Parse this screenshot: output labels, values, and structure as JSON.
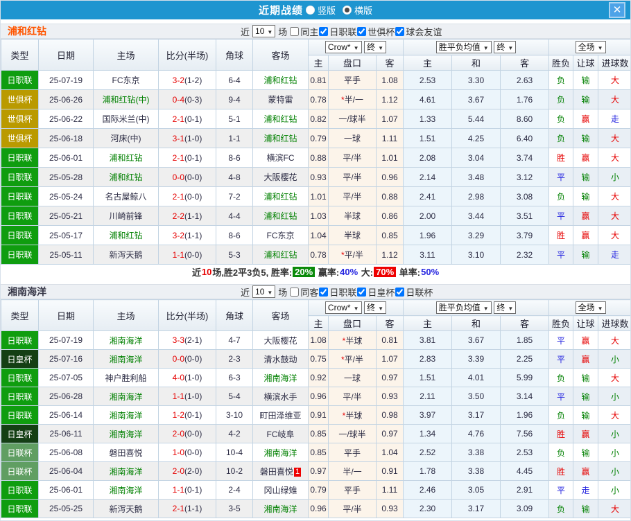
{
  "titlebar": {
    "title": "近期战绩",
    "radio_options": [
      {
        "label": "竖版",
        "selected": false
      },
      {
        "label": "横版",
        "selected": true
      }
    ],
    "close_label": "✕"
  },
  "columns": {
    "type": "类型",
    "date": "日期",
    "home": "主场",
    "score": "比分(半场)",
    "corners": "角球",
    "away": "客场",
    "odds_group": {
      "dropdown1": "Crow*",
      "dropdown2": "终",
      "sub": [
        "主",
        "盘口",
        "客"
      ]
    },
    "mean_group": {
      "dropdown1": "胜平负均值",
      "dropdown2": "终",
      "sub": [
        "主",
        "和",
        "客"
      ]
    },
    "result_group": {
      "dropdown": "全场",
      "sub": [
        "胜负",
        "让球",
        "进球数"
      ]
    }
  },
  "colors": {
    "red": "#e60000",
    "green": "#008000",
    "blue": "#2424e0",
    "dark": "#2c2c44"
  },
  "comp_colors": {
    "日职联": "#0f9d0f",
    "世俱杯": "#ba9a00",
    "日皇杯": "#143f14",
    "日联杯": "#609e62"
  },
  "sections": [
    {
      "team": "浦和红钻",
      "team_color": "#ff5500",
      "filters": {
        "near_label": "近",
        "count": "10",
        "games_label": "场",
        "checkboxes": [
          {
            "label": "同主",
            "checked": false
          },
          {
            "label": "日职联",
            "checked": true
          },
          {
            "label": "世俱杯",
            "checked": true
          },
          {
            "label": "球会友谊",
            "checked": true
          }
        ]
      },
      "rows": [
        {
          "comp": "日职联",
          "date": "25-07-19",
          "home": "FC东京",
          "home_self": false,
          "score": "3-2",
          "half": "(1-2)",
          "corners": "6-4",
          "away": "浦和红钻",
          "away_self": true,
          "o1": "0.81",
          "hstar": false,
          "hcap": "平手",
          "o2": "1.08",
          "m1": "2.53",
          "m2": "3.30",
          "m3": "2.63",
          "res": "负",
          "res_c": "g",
          "let": "输",
          "let_c": "g",
          "goal": "大",
          "goal_c": "r"
        },
        {
          "comp": "世俱杯",
          "date": "25-06-26",
          "home": "浦和红钻(中)",
          "home_self": true,
          "score": "0-4",
          "half": "(0-3)",
          "corners": "9-4",
          "away": "蒙特雷",
          "away_self": false,
          "o1": "0.78",
          "hstar": true,
          "hcap": "半/一",
          "o2": "1.12",
          "m1": "4.61",
          "m2": "3.67",
          "m3": "1.76",
          "res": "负",
          "res_c": "g",
          "let": "输",
          "let_c": "g",
          "goal": "大",
          "goal_c": "r"
        },
        {
          "comp": "世俱杯",
          "date": "25-06-22",
          "home": "国际米兰(中)",
          "home_self": false,
          "score": "2-1",
          "half": "(0-1)",
          "corners": "5-1",
          "away": "浦和红钻",
          "away_self": true,
          "o1": "0.82",
          "hstar": false,
          "hcap": "一/球半",
          "o2": "1.07",
          "m1": "1.33",
          "m2": "5.44",
          "m3": "8.60",
          "res": "负",
          "res_c": "g",
          "let": "赢",
          "let_c": "r",
          "goal": "走",
          "goal_c": "b"
        },
        {
          "comp": "世俱杯",
          "date": "25-06-18",
          "home": "河床(中)",
          "home_self": false,
          "score": "3-1",
          "half": "(1-0)",
          "corners": "1-1",
          "away": "浦和红钻",
          "away_self": true,
          "o1": "0.79",
          "hstar": false,
          "hcap": "一球",
          "o2": "1.11",
          "m1": "1.51",
          "m2": "4.25",
          "m3": "6.40",
          "res": "负",
          "res_c": "g",
          "let": "输",
          "let_c": "g",
          "goal": "大",
          "goal_c": "r"
        },
        {
          "comp": "日职联",
          "date": "25-06-01",
          "home": "浦和红钻",
          "home_self": true,
          "score": "2-1",
          "half": "(0-1)",
          "corners": "8-6",
          "away": "横滨FC",
          "away_self": false,
          "o1": "0.88",
          "hstar": false,
          "hcap": "平/半",
          "o2": "1.01",
          "m1": "2.08",
          "m2": "3.04",
          "m3": "3.74",
          "res": "胜",
          "res_c": "r",
          "let": "赢",
          "let_c": "r",
          "goal": "大",
          "goal_c": "r"
        },
        {
          "comp": "日职联",
          "date": "25-05-28",
          "home": "浦和红钻",
          "home_self": true,
          "score": "0-0",
          "half": "(0-0)",
          "corners": "4-8",
          "away": "大阪樱花",
          "away_self": false,
          "o1": "0.93",
          "hstar": false,
          "hcap": "平/半",
          "o2": "0.96",
          "m1": "2.14",
          "m2": "3.48",
          "m3": "3.12",
          "res": "平",
          "res_c": "b",
          "let": "输",
          "let_c": "g",
          "goal": "小",
          "goal_c": "g"
        },
        {
          "comp": "日职联",
          "date": "25-05-24",
          "home": "名古屋鲸八",
          "home_self": false,
          "score": "2-1",
          "half": "(0-0)",
          "corners": "7-2",
          "away": "浦和红钻",
          "away_self": true,
          "o1": "1.01",
          "hstar": false,
          "hcap": "平/半",
          "o2": "0.88",
          "m1": "2.41",
          "m2": "2.98",
          "m3": "3.08",
          "res": "负",
          "res_c": "g",
          "let": "输",
          "let_c": "g",
          "goal": "大",
          "goal_c": "r"
        },
        {
          "comp": "日职联",
          "date": "25-05-21",
          "home": "川崎前锋",
          "home_self": false,
          "score": "2-2",
          "half": "(1-1)",
          "corners": "4-4",
          "away": "浦和红钻",
          "away_self": true,
          "o1": "1.03",
          "hstar": false,
          "hcap": "半球",
          "o2": "0.86",
          "m1": "2.00",
          "m2": "3.44",
          "m3": "3.51",
          "res": "平",
          "res_c": "b",
          "let": "赢",
          "let_c": "r",
          "goal": "大",
          "goal_c": "r"
        },
        {
          "comp": "日职联",
          "date": "25-05-17",
          "home": "浦和红钻",
          "home_self": true,
          "score": "3-2",
          "half": "(1-1)",
          "corners": "8-6",
          "away": "FC东京",
          "away_self": false,
          "o1": "1.04",
          "hstar": false,
          "hcap": "半球",
          "o2": "0.85",
          "m1": "1.96",
          "m2": "3.29",
          "m3": "3.79",
          "res": "胜",
          "res_c": "r",
          "let": "赢",
          "let_c": "r",
          "goal": "大",
          "goal_c": "r"
        },
        {
          "comp": "日职联",
          "date": "25-05-11",
          "home": "新泻天鹅",
          "home_self": false,
          "score": "1-1",
          "half": "(0-0)",
          "corners": "5-3",
          "away": "浦和红钻",
          "away_self": true,
          "o1": "0.78",
          "hstar": true,
          "hcap": "平/半",
          "o2": "1.12",
          "m1": "3.11",
          "m2": "3.10",
          "m3": "2.32",
          "res": "平",
          "res_c": "b",
          "let": "输",
          "let_c": "g",
          "goal": "走",
          "goal_c": "b"
        }
      ],
      "summary": [
        {
          "t": "近",
          "c": "#333333"
        },
        {
          "t": "10",
          "c": "#e60000"
        },
        {
          "t": "场,胜2平3负5, 胜率:",
          "c": "#333333"
        },
        {
          "t": "20%",
          "c": "#ffffff",
          "bg": "#0a8a0a"
        },
        {
          "t": " 赢率:",
          "c": "#333333"
        },
        {
          "t": "40%",
          "c": "#2424e0"
        },
        {
          "t": " 大:",
          "c": "#333333"
        },
        {
          "t": "70%",
          "c": "#ffffff",
          "bg": "#ee0000"
        },
        {
          "t": " 单率:",
          "c": "#333333"
        },
        {
          "t": "50%",
          "c": "#2424e0"
        }
      ]
    },
    {
      "team": "湘南海洋",
      "team_color": "#333344",
      "filters": {
        "near_label": "近",
        "count": "10",
        "games_label": "场",
        "checkboxes": [
          {
            "label": "同客",
            "checked": false
          },
          {
            "label": "日职联",
            "checked": true
          },
          {
            "label": "日皇杯",
            "checked": true
          },
          {
            "label": "日联杯",
            "checked": true
          }
        ]
      },
      "rows": [
        {
          "comp": "日职联",
          "date": "25-07-19",
          "home": "湘南海洋",
          "home_self": true,
          "score": "3-3",
          "half": "(2-1)",
          "corners": "4-7",
          "away": "大阪樱花",
          "away_self": false,
          "o1": "1.08",
          "hstar": true,
          "hcap": "半球",
          "o2": "0.81",
          "m1": "3.81",
          "m2": "3.67",
          "m3": "1.85",
          "res": "平",
          "res_c": "b",
          "let": "赢",
          "let_c": "r",
          "goal": "大",
          "goal_c": "r"
        },
        {
          "comp": "日皇杯",
          "date": "25-07-16",
          "home": "湘南海洋",
          "home_self": true,
          "score": "0-0",
          "half": "(0-0)",
          "corners": "2-3",
          "away": "清水鼓动",
          "away_self": false,
          "o1": "0.75",
          "hstar": true,
          "hcap": "平/半",
          "o2": "1.07",
          "m1": "2.83",
          "m2": "3.39",
          "m3": "2.25",
          "res": "平",
          "res_c": "b",
          "let": "赢",
          "let_c": "r",
          "goal": "小",
          "goal_c": "g"
        },
        {
          "comp": "日职联",
          "date": "25-07-05",
          "home": "神户胜利船",
          "home_self": false,
          "score": "4-0",
          "half": "(1-0)",
          "corners": "6-3",
          "away": "湘南海洋",
          "away_self": true,
          "o1": "0.92",
          "hstar": false,
          "hcap": "一球",
          "o2": "0.97",
          "m1": "1.51",
          "m2": "4.01",
          "m3": "5.99",
          "res": "负",
          "res_c": "g",
          "let": "输",
          "let_c": "g",
          "goal": "大",
          "goal_c": "r"
        },
        {
          "comp": "日职联",
          "date": "25-06-28",
          "home": "湘南海洋",
          "home_self": true,
          "score": "1-1",
          "half": "(1-0)",
          "corners": "5-4",
          "away": "横滨水手",
          "away_self": false,
          "o1": "0.96",
          "hstar": false,
          "hcap": "平/半",
          "o2": "0.93",
          "m1": "2.11",
          "m2": "3.50",
          "m3": "3.14",
          "res": "平",
          "res_c": "b",
          "let": "输",
          "let_c": "g",
          "goal": "小",
          "goal_c": "g"
        },
        {
          "comp": "日职联",
          "date": "25-06-14",
          "home": "湘南海洋",
          "home_self": true,
          "score": "1-2",
          "half": "(0-1)",
          "corners": "3-10",
          "away": "町田泽维亚",
          "away_self": false,
          "o1": "0.91",
          "hstar": true,
          "hcap": "半球",
          "o2": "0.98",
          "m1": "3.97",
          "m2": "3.17",
          "m3": "1.96",
          "res": "负",
          "res_c": "g",
          "let": "输",
          "let_c": "g",
          "goal": "大",
          "goal_c": "r"
        },
        {
          "comp": "日皇杯",
          "date": "25-06-11",
          "home": "湘南海洋",
          "home_self": true,
          "score": "2-0",
          "half": "(0-0)",
          "corners": "4-2",
          "away": "FC岐阜",
          "away_self": false,
          "o1": "0.85",
          "hstar": false,
          "hcap": "一/球半",
          "o2": "0.97",
          "m1": "1.34",
          "m2": "4.76",
          "m3": "7.56",
          "res": "胜",
          "res_c": "r",
          "let": "赢",
          "let_c": "r",
          "goal": "小",
          "goal_c": "g"
        },
        {
          "comp": "日联杯",
          "date": "25-06-08",
          "home": "磐田喜悦",
          "home_self": false,
          "score": "1-0",
          "half": "(0-0)",
          "corners": "10-4",
          "away": "湘南海洋",
          "away_self": true,
          "o1": "0.85",
          "hstar": false,
          "hcap": "平手",
          "o2": "1.04",
          "m1": "2.52",
          "m2": "3.38",
          "m3": "2.53",
          "res": "负",
          "res_c": "g",
          "let": "输",
          "let_c": "g",
          "goal": "小",
          "goal_c": "g"
        },
        {
          "comp": "日联杯",
          "date": "25-06-04",
          "home": "湘南海洋",
          "home_self": true,
          "score": "2-0",
          "half": "(2-0)",
          "corners": "10-2",
          "away": "磐田喜悦",
          "away_self": false,
          "away_badge": "1",
          "o1": "0.97",
          "hstar": false,
          "hcap": "半/一",
          "o2": "0.91",
          "m1": "1.78",
          "m2": "3.38",
          "m3": "4.45",
          "res": "胜",
          "res_c": "r",
          "let": "赢",
          "let_c": "r",
          "goal": "小",
          "goal_c": "g"
        },
        {
          "comp": "日职联",
          "date": "25-06-01",
          "home": "湘南海洋",
          "home_self": true,
          "score": "1-1",
          "half": "(0-1)",
          "corners": "2-4",
          "away": "冈山绿雉",
          "away_self": false,
          "o1": "0.79",
          "hstar": false,
          "hcap": "平手",
          "o2": "1.11",
          "m1": "2.46",
          "m2": "3.05",
          "m3": "2.91",
          "res": "平",
          "res_c": "b",
          "let": "走",
          "let_c": "b",
          "goal": "小",
          "goal_c": "g"
        },
        {
          "comp": "日职联",
          "date": "25-05-25",
          "home": "新泻天鹅",
          "home_self": false,
          "score": "2-1",
          "half": "(1-1)",
          "corners": "3-5",
          "away": "湘南海洋",
          "away_self": true,
          "o1": "0.96",
          "hstar": false,
          "hcap": "平/半",
          "o2": "0.93",
          "m1": "2.30",
          "m2": "3.17",
          "m3": "3.09",
          "res": "负",
          "res_c": "g",
          "let": "输",
          "let_c": "g",
          "goal": "大",
          "goal_c": "r"
        }
      ]
    }
  ]
}
